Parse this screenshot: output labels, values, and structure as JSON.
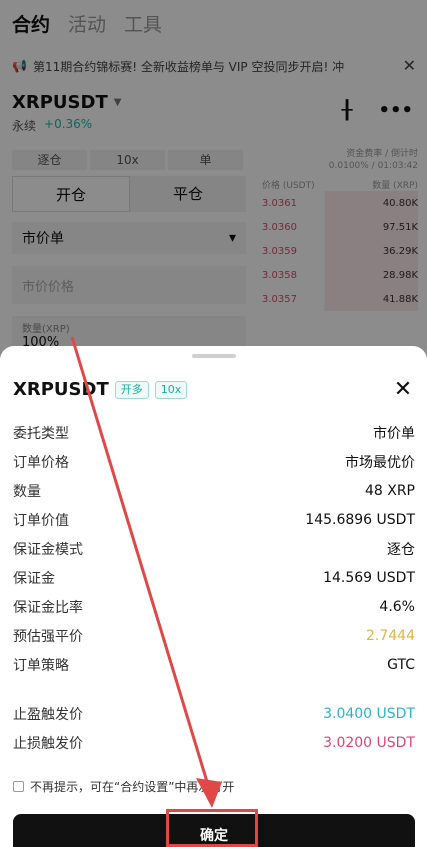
{
  "background": {
    "tabs": [
      {
        "label": "合约",
        "active": true
      },
      {
        "label": "活动",
        "active": false
      },
      {
        "label": "工具",
        "active": false
      }
    ],
    "banner": "第11期合约锦标赛! 全新收益榜单与 VIP 空投同步开启!  冲",
    "symbol": "XRPUSDT",
    "contract_type": "永续",
    "change": "+0.36%",
    "margin_mode": "逐仓",
    "leverage": "10x",
    "single": "单",
    "open_label": "开仓",
    "close_label": "平仓",
    "order_type": "市价单",
    "input_placeholder": "市价价格",
    "qty_label": "数量(XRP)",
    "qty_value": "100%",
    "funding_head": "资金费率 / 倒计时",
    "funding_value": "0.0100% / 01:03:42",
    "col_price": "价格 (USDT)",
    "col_amount": "数量 (XRP)",
    "asks": [
      {
        "price": "3.0361",
        "amount": "40.80K"
      },
      {
        "price": "3.0360",
        "amount": "97.51K"
      },
      {
        "price": "3.0359",
        "amount": "36.29K"
      },
      {
        "price": "3.0358",
        "amount": "28.98K"
      },
      {
        "price": "3.0357",
        "amount": "41.88K"
      }
    ]
  },
  "sheet": {
    "symbol": "XRPUSDT",
    "side_tag": "开多",
    "leverage_tag": "10x",
    "rows": [
      {
        "key": "委托类型",
        "value": "市价单"
      },
      {
        "key": "订单价格",
        "value": "市场最优价"
      },
      {
        "key": "数量",
        "value": "48 XRP"
      },
      {
        "key": "订单价值",
        "value": "145.6896 USDT"
      },
      {
        "key": "保证金模式",
        "value": "逐仓"
      },
      {
        "key": "保证金",
        "value": "14.569 USDT"
      },
      {
        "key": "保证金比率",
        "value": "4.6%"
      },
      {
        "key": "预估强平价",
        "value": "2.7444"
      },
      {
        "key": "订单策略",
        "value": "GTC"
      }
    ],
    "take_profit": {
      "key": "止盈触发价",
      "value": "3.0400 USDT"
    },
    "stop_loss": {
      "key": "止损触发价",
      "value": "3.0200 USDT"
    },
    "dont_show": "不再提示，可在“合约设置”中再次打开",
    "confirm_label": "确定",
    "colors": {
      "yellow": "#e3b341",
      "teal": "#2ab4c7",
      "pink": "#d9476f",
      "annotation": "#e04848"
    }
  }
}
